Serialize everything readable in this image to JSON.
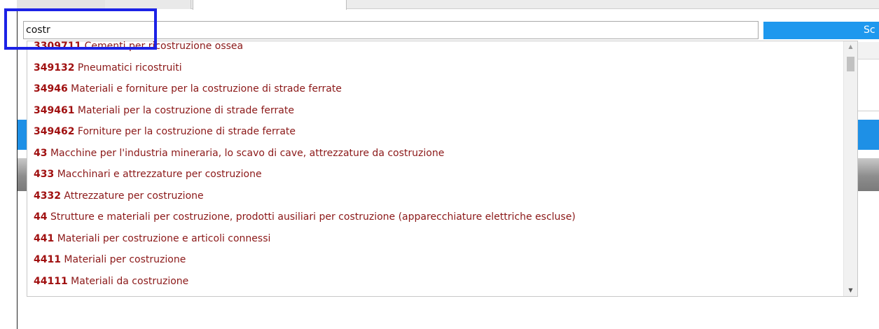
{
  "search": {
    "value": "costr",
    "button_label": "Sc"
  },
  "dropdown": {
    "items": [
      {
        "code": "3309711",
        "label": "Cementi per ricostruzione ossea"
      },
      {
        "code": "349132",
        "label": "Pneumatici ricostruiti"
      },
      {
        "code": "34946",
        "label": "Materiali e forniture per la costruzione di strade ferrate"
      },
      {
        "code": "349461",
        "label": "Materiali per la costruzione di strade ferrate"
      },
      {
        "code": "349462",
        "label": "Forniture per la costruzione di strade ferrate"
      },
      {
        "code": "43",
        "label": "Macchine per l'industria mineraria, lo scavo di cave, attrezzature da costruzione"
      },
      {
        "code": "433",
        "label": "Macchinari e attrezzature per costruzione"
      },
      {
        "code": "4332",
        "label": "Attrezzature per costruzione"
      },
      {
        "code": "44",
        "label": "Strutture e materiali per costruzione, prodotti ausiliari per costruzione (apparecchiature elettriche escluse)"
      },
      {
        "code": "441",
        "label": "Materiali per costruzione e articoli connessi"
      },
      {
        "code": "4411",
        "label": "Materiali per costruzione"
      },
      {
        "code": "44111",
        "label": "Materiali da costruzione"
      }
    ]
  },
  "colors": {
    "item_text": "#8b1818",
    "accent_blue": "#1e98ee",
    "highlight": "#1c22e6"
  }
}
